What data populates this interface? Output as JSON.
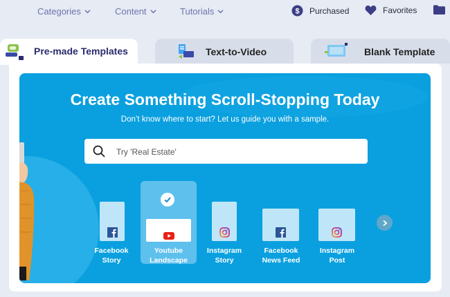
{
  "nav": {
    "categories": "Categories",
    "content": "Content",
    "tutorials": "Tutorials",
    "purchased": "Purchased",
    "favorites": "Favorites"
  },
  "tabs": [
    {
      "label": "Pre-made Templates",
      "active": true
    },
    {
      "label": "Text-to-Video",
      "active": false
    },
    {
      "label": "Blank Template",
      "active": false
    }
  ],
  "hero": {
    "title": "Create Something Scroll-Stopping Today",
    "subtitle": "Don’t know where to start? Let us guide you with a sample.",
    "search_placeholder": "Try 'Real Estate'"
  },
  "templates": [
    {
      "line1": "Facebook",
      "line2": "Story",
      "icon": "facebook-icon",
      "selected": false
    },
    {
      "line1": "Youtube",
      "line2": "Landscape",
      "icon": "youtube-icon",
      "selected": true
    },
    {
      "line1": "Instagram",
      "line2": "Story",
      "icon": "instagram-icon",
      "selected": false
    },
    {
      "line1": "Facebook",
      "line2": "News Feed",
      "icon": "facebook-icon",
      "selected": false
    },
    {
      "line1": "Instagram",
      "line2": "Post",
      "icon": "instagram-icon",
      "selected": false
    }
  ],
  "colors": {
    "hero_bg": "#0aa0df",
    "accent": "#2b2b6e",
    "nav_text": "#6f74ad",
    "youtube_red": "#e62117",
    "facebook_blue": "#2b5597"
  }
}
